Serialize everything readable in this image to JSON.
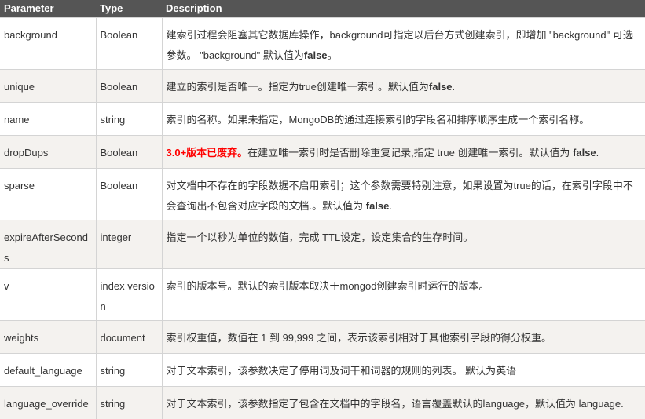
{
  "table": {
    "headers": [
      "Parameter",
      "Type",
      "Description"
    ],
    "rows": [
      {
        "parameter": "background",
        "type": "Boolean",
        "desc_pre": "建索引过程会阻塞其它数据库操作，background可指定以后台方式创建索引，即增加 \"background\" 可选参数。 \"background\" 默认值为",
        "desc_bold": "false",
        "desc_post": "。"
      },
      {
        "parameter": "unique",
        "type": "Boolean",
        "desc_pre": "建立的索引是否唯一。指定为true创建唯一索引。默认值为",
        "desc_bold": "false",
        "desc_post": "."
      },
      {
        "parameter": "name",
        "type": "string",
        "desc_pre": "索引的名称。如果未指定，MongoDB的通过连接索引的字段名和排序顺序生成一个索引名称。"
      },
      {
        "parameter": "dropDups",
        "type": "Boolean",
        "desc_warn": "3.0+版本已废弃。",
        "desc_pre": "在建立唯一索引时是否删除重复记录,指定 true 创建唯一索引。默认值为 ",
        "desc_bold": "false",
        "desc_post": "."
      },
      {
        "parameter": "sparse",
        "type": "Boolean",
        "desc_pre": "对文档中不存在的字段数据不启用索引；这个参数需要特别注意，如果设置为true的话，在索引字段中不会查询出不包含对应字段的文档.。默认值为 ",
        "desc_bold": "false",
        "desc_post": "."
      },
      {
        "parameter": "expireAfterSeconds",
        "type": "integer",
        "desc_pre": "指定一个以秒为单位的数值，完成 TTL设定，设定集合的生存时间。"
      },
      {
        "parameter": "v",
        "type": "index version",
        "desc_pre": "索引的版本号。默认的索引版本取决于mongod创建索引时运行的版本。"
      },
      {
        "parameter": "weights",
        "type": "document",
        "desc_pre": "索引权重值，数值在 1 到 99,999 之间，表示该索引相对于其他索引字段的得分权重。"
      },
      {
        "parameter": "default_language",
        "type": "string",
        "desc_pre": "对于文本索引，该参数决定了停用词及词干和词器的规则的列表。 默认为英语"
      },
      {
        "parameter": "language_override",
        "type": "string",
        "desc_pre": "对于文本索引，该参数指定了包含在文档中的字段名，语言覆盖默认的language，默认值为 language."
      }
    ]
  },
  "colors": {
    "header_bg": "#555555",
    "header_text": "#ffffff",
    "row_alt_bg": "#f4f2ef",
    "border": "#d4d4d4",
    "warning_text": "#ff0000"
  }
}
